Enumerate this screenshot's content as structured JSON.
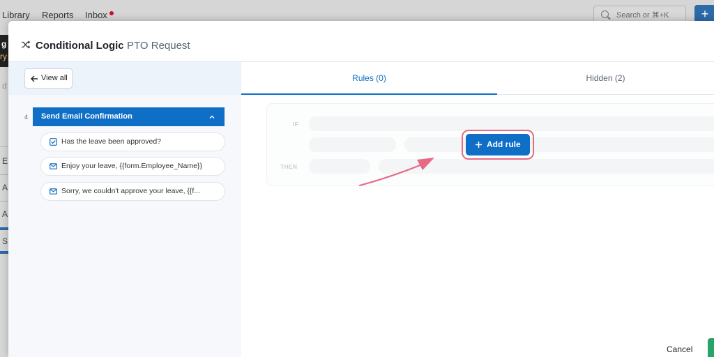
{
  "background": {
    "nav_items": [
      "Library",
      "Reports",
      "Inbox"
    ],
    "search_placeholder": "Search or ⌘+K",
    "plus_label": "+",
    "left_fragments": [
      "g",
      "ry",
      "d",
      "E",
      "A",
      "A",
      "S"
    ]
  },
  "modal": {
    "title": "Conditional Logic",
    "subtitle": "PTO Request"
  },
  "sidebar": {
    "view_all_label": "View all",
    "step_number": "4",
    "step_label": "Send Email Confirmation",
    "actions": [
      {
        "icon": "checkbox-icon",
        "label": "Has the leave been approved?"
      },
      {
        "icon": "envelope-icon",
        "label": "Enjoy your leave, {{form.Employee_Name}}"
      },
      {
        "icon": "envelope-icon",
        "label": "Sorry, we couldn't approve your leave, {{f..."
      }
    ]
  },
  "tabs": [
    {
      "label": "Rules (0)",
      "active": true
    },
    {
      "label": "Hidden (2)",
      "active": false
    }
  ],
  "rule_builder": {
    "if_label": "IF",
    "then_label": "THEN",
    "add_rule_label": "Add rule"
  },
  "footer": {
    "cancel_label": "Cancel"
  },
  "colors": {
    "primary": "#0f6fc6",
    "highlight": "#e76a85",
    "save": "#2aa36b"
  }
}
